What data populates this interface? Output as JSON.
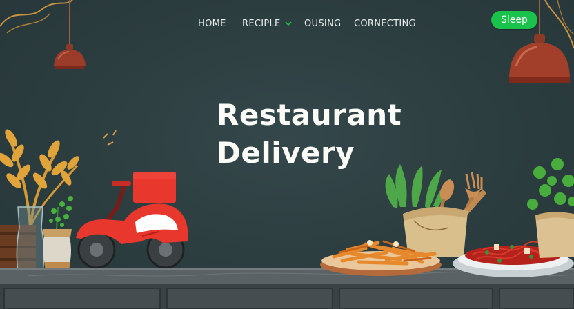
{
  "nav": {
    "items": [
      {
        "label": "HOME"
      },
      {
        "label": "RECIPLE"
      },
      {
        "label": "OUSING"
      },
      {
        "label": "CORNECTING"
      }
    ]
  },
  "header": {
    "action_button_label": "Sleep"
  },
  "hero": {
    "line1": "Restaurant",
    "line2": "Delivery"
  },
  "colors": {
    "background": "#2c3d3f",
    "accent_button": "#19c24a",
    "scooter": "#e8382d",
    "counter": "#5a6266"
  },
  "icons": [
    "chevron-down-icon",
    "pendant-lamp-icon",
    "scooter-icon",
    "fork-icon",
    "spoon-icon",
    "plant-icon"
  ]
}
